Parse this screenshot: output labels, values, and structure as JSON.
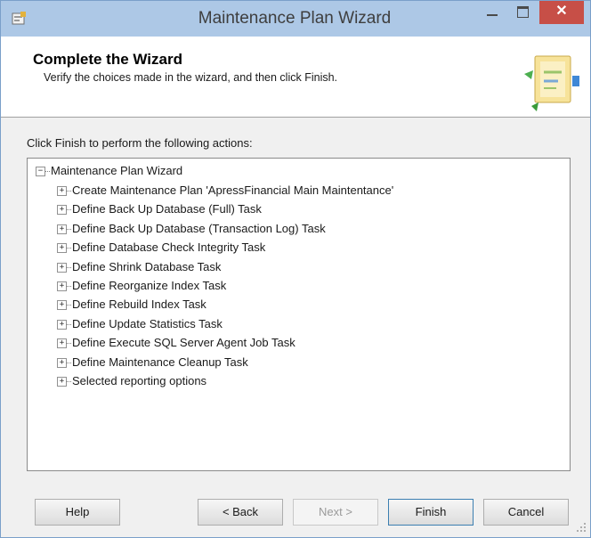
{
  "window": {
    "title": "Maintenance Plan Wizard",
    "close_glyph": "✕",
    "accent_color": "#adc8e6",
    "close_color": "#c74f47"
  },
  "header": {
    "title": "Complete the Wizard",
    "subtitle": "Verify the choices made in the wizard, and then click Finish."
  },
  "main": {
    "actions_label": "Click Finish to perform the following actions:",
    "tree": {
      "root": {
        "label": "Maintenance Plan Wizard",
        "expanded": true,
        "expander_glyph": "−"
      },
      "child_expander_glyph": "+",
      "items": [
        "Create Maintenance Plan 'ApressFinancial Main Maintentance'",
        "Define Back Up Database (Full) Task",
        "Define Back Up Database (Transaction Log) Task",
        "Define Database Check Integrity Task",
        "Define Shrink Database Task",
        "Define Reorganize Index Task",
        "Define Rebuild Index Task",
        "Define Update Statistics Task",
        "Define Execute SQL Server Agent Job Task",
        "Define Maintenance Cleanup Task",
        "Selected reporting options"
      ]
    }
  },
  "footer": {
    "help_label": "Help",
    "back_label": "< Back",
    "next_label": "Next >",
    "next_enabled": false,
    "finish_label": "Finish",
    "cancel_label": "Cancel"
  }
}
